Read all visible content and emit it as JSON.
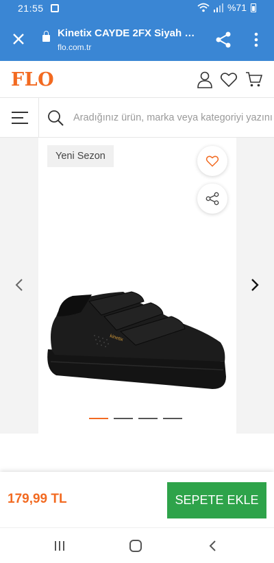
{
  "status_bar": {
    "time": "21:55",
    "battery": "%71"
  },
  "browser": {
    "page_title": "Kinetix CAYDE 2FX Siyah Ka...",
    "url": "flo.com.tr"
  },
  "site": {
    "logo": "FLO",
    "brand_color": "#f26a21"
  },
  "search": {
    "placeholder": "Aradığınız ürün, marka veya kategoriyi yazını"
  },
  "product": {
    "badge": "Yeni Sezon",
    "image_brand_text": "kinetix",
    "gallery_count": 4,
    "gallery_active_index": 0
  },
  "purchase": {
    "price": "179,99 TL",
    "add_to_cart_label": "SEPETE EKLE",
    "button_color": "#2ea34a"
  },
  "icons": [
    "close-icon",
    "lock-icon",
    "share-icon",
    "more-vert-icon",
    "user-icon",
    "heart-icon",
    "cart-icon",
    "hamburger-icon",
    "search-icon",
    "chevron-left-icon",
    "chevron-right-icon",
    "recents-icon",
    "home-icon",
    "back-icon"
  ]
}
